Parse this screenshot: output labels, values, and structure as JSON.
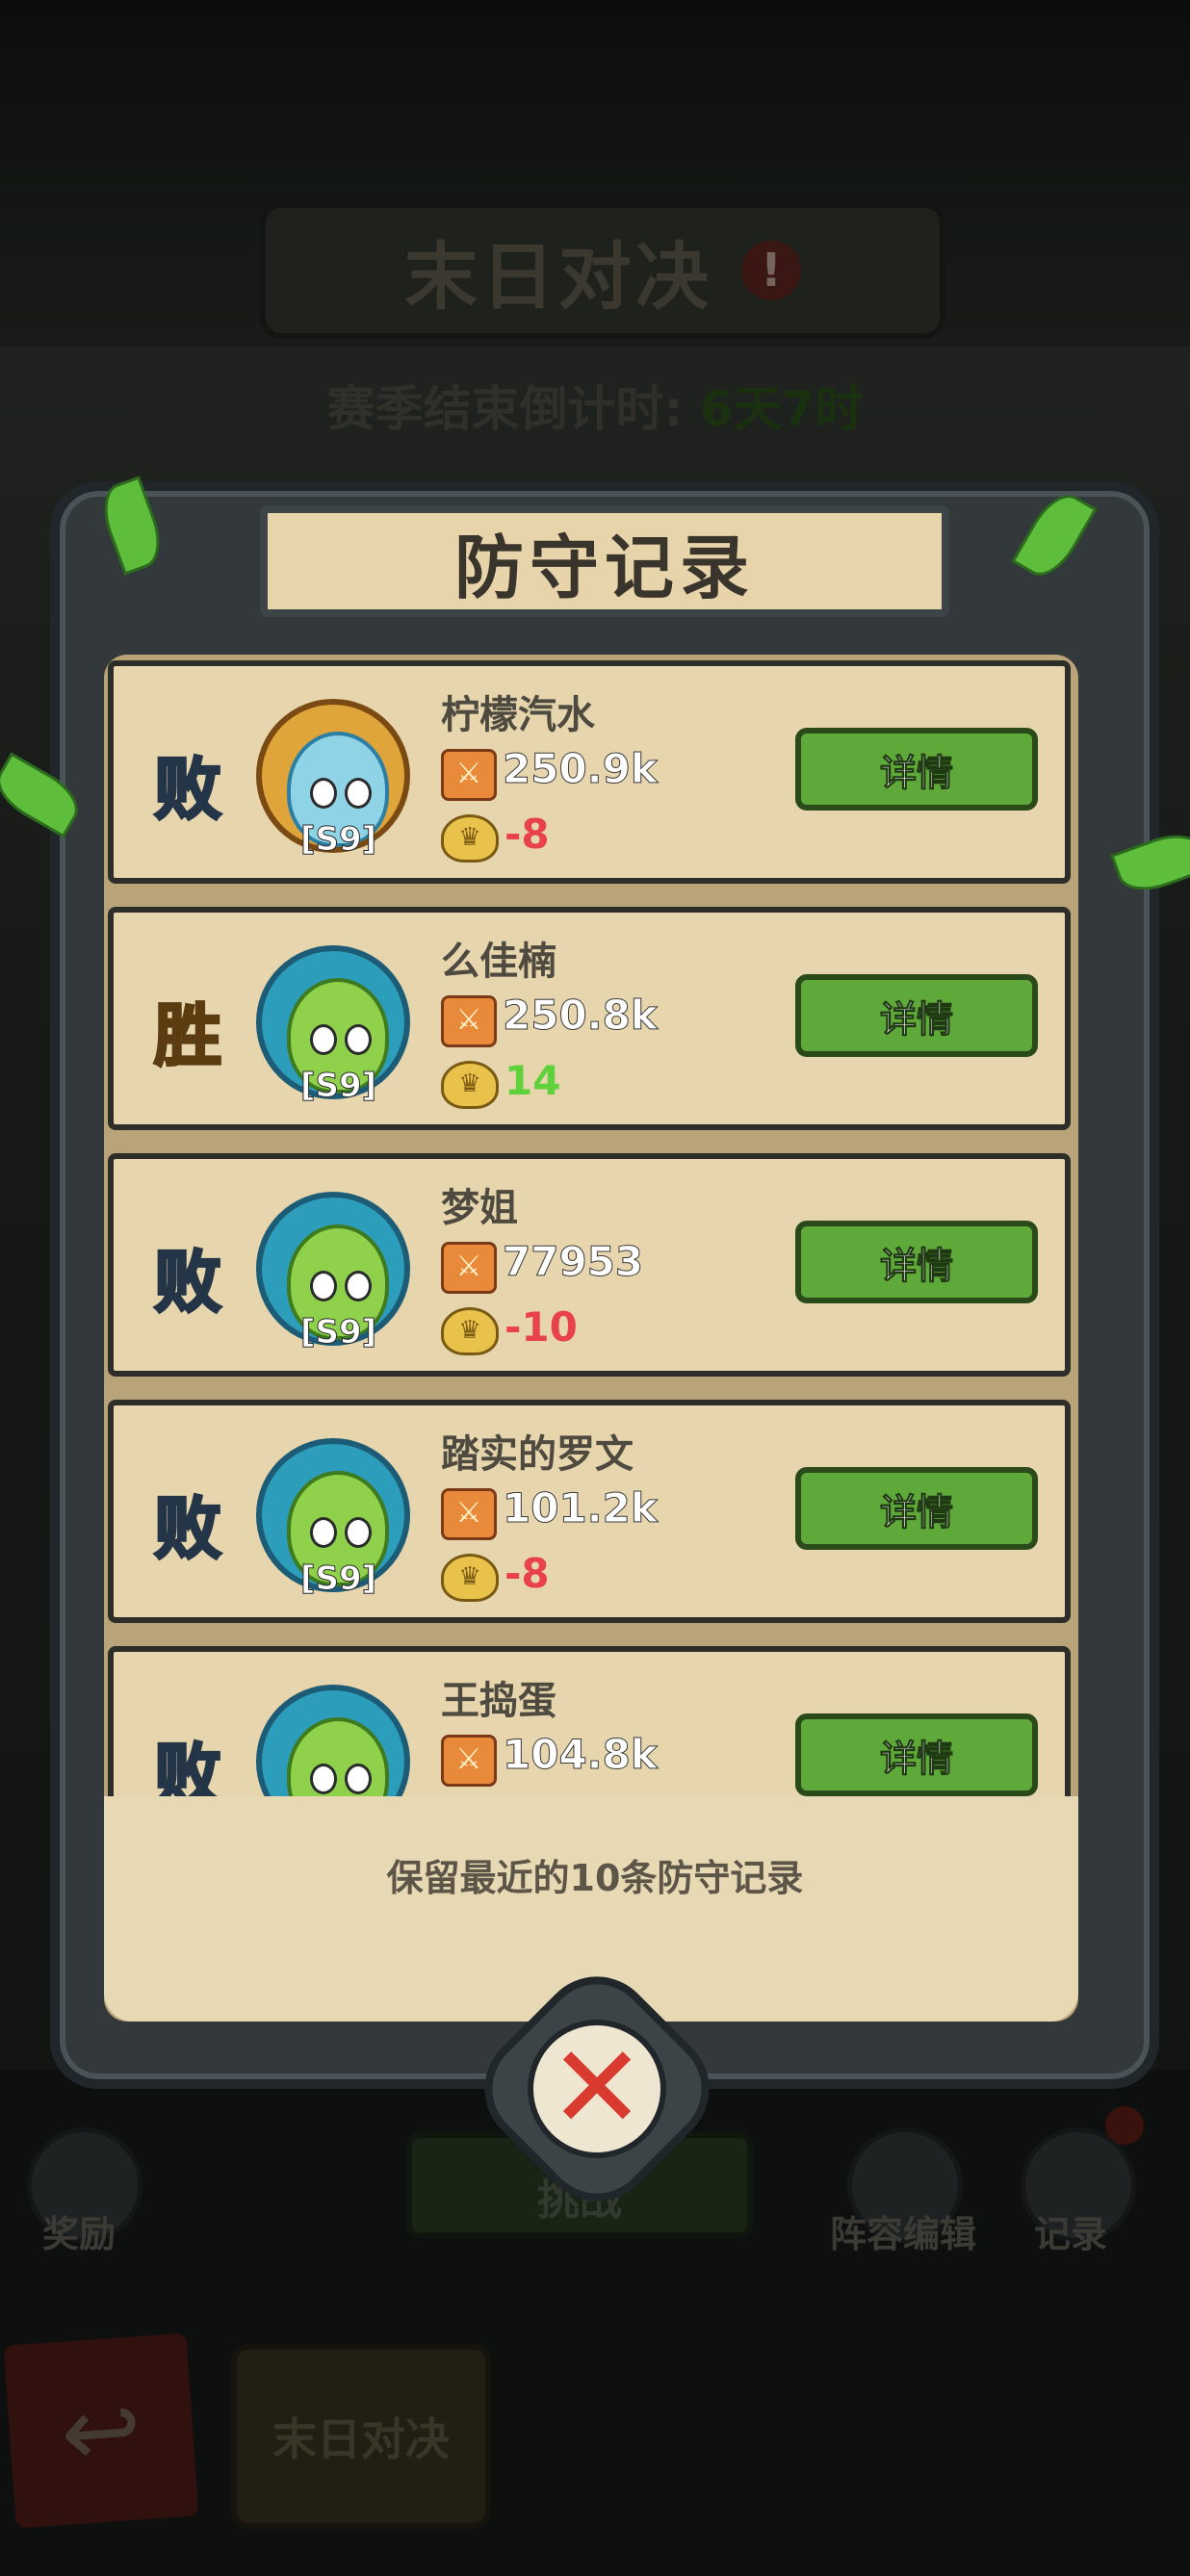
{
  "screen": {
    "title": "末日对决",
    "warning_symbol": "!",
    "countdown_label": "赛季结束倒计时:",
    "countdown_value": "6天7时"
  },
  "modal": {
    "title": "防守记录",
    "footer_note": "保留最近的10条防守记录",
    "records": [
      {
        "result": "败",
        "outcome": "lose",
        "name": "柠檬汽水",
        "season": "[S9]",
        "power": "250.9k",
        "delta": "-8",
        "avatar": "blue-ghost-plant",
        "detail_label": "详情"
      },
      {
        "result": "胜",
        "outcome": "win",
        "name": "么佳楠",
        "season": "[S9]",
        "power": "250.8k",
        "delta": "14",
        "avatar": "green-sprout",
        "detail_label": "详情"
      },
      {
        "result": "败",
        "outcome": "lose",
        "name": "梦姐",
        "season": "[S9]",
        "power": "77953",
        "delta": "-10",
        "avatar": "green-sprout",
        "detail_label": "详情"
      },
      {
        "result": "败",
        "outcome": "lose",
        "name": "踏实的罗文",
        "season": "[S9]",
        "power": "101.2k",
        "delta": "-8",
        "avatar": "green-sprout",
        "detail_label": "详情"
      },
      {
        "result": "败",
        "outcome": "lose",
        "name": "王捣蛋",
        "season": "",
        "power": "104.8k",
        "delta": "",
        "avatar": "green-sprout",
        "detail_label": "详情"
      }
    ],
    "close_symbol": "✕"
  },
  "bottom_bar": {
    "rewards_label": "奖励",
    "challenge_label": "挑战",
    "lineup_label": "阵容编辑",
    "records_label": "记录",
    "back_symbol": "↩",
    "scene_tab_label": "末日对决"
  },
  "colors": {
    "lose_text": "#a9c4e6",
    "win_text": "#f3c94d",
    "negative_delta": "#e8434a",
    "positive_delta": "#5fd13a",
    "detail_button": "#5fa83a",
    "close_x": "#d93a30"
  }
}
